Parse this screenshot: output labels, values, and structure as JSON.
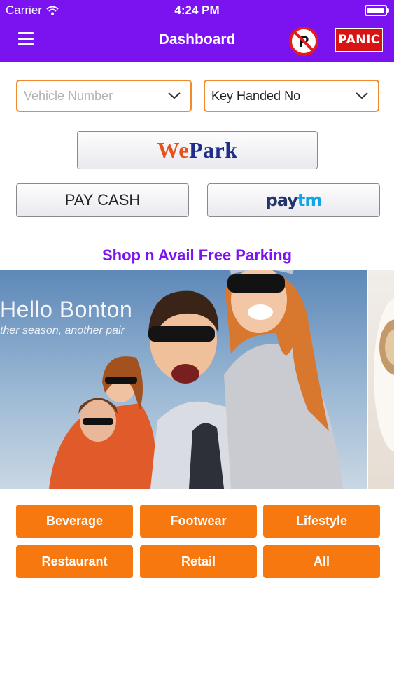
{
  "status_bar": {
    "carrier": "Carrier",
    "time": "4:24 PM"
  },
  "navbar": {
    "title": "Dashboard",
    "menu_icon": "hamburger-menu-icon",
    "no_parking_icon": "no-parking-icon",
    "panic_label": "PANIC",
    "background_color": "#7b12f0"
  },
  "filters": {
    "vehicle_number_placeholder": "Vehicle Number",
    "key_handed_value": "Key Handed No"
  },
  "actions": {
    "wepark_logo_we": "We",
    "wepark_logo_park": "Park",
    "pay_cash_label": "PAY CASH",
    "paytm_logo_pay": "pay",
    "paytm_logo_tm": "tm"
  },
  "promo": {
    "title": "Shop n Avail Free Parking",
    "banner_headline": "Hello Bonton",
    "banner_tagline": "ther season, another pair"
  },
  "categories": [
    {
      "label": "Beverage"
    },
    {
      "label": "Footwear"
    },
    {
      "label": "Lifestyle"
    },
    {
      "label": "Restaurant"
    },
    {
      "label": "Retail"
    },
    {
      "label": "All"
    }
  ],
  "colors": {
    "accent_orange": "#f7780f",
    "brand_purple": "#7b12f0",
    "panic_red": "#d81313"
  }
}
